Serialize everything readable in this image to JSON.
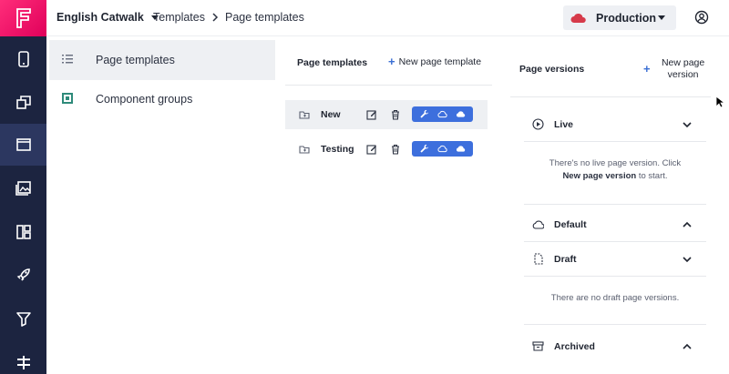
{
  "colors": {
    "rail": "#1c2440",
    "rail_active": "#2c3760",
    "brand": "#ff2d7a",
    "accent": "#3d6fdd",
    "env_cloud": "#d63a4a"
  },
  "rail": {
    "logo_icon": "flotiq-logo-icon",
    "items": [
      {
        "icon": "device-icon",
        "active": false
      },
      {
        "icon": "layers-icon",
        "active": false
      },
      {
        "icon": "window-icon",
        "active": true
      },
      {
        "icon": "gallery-icon",
        "active": false
      },
      {
        "icon": "dashboard-icon",
        "active": false
      },
      {
        "icon": "rocket-icon",
        "active": false
      },
      {
        "icon": "filter-icon",
        "active": false
      },
      {
        "icon": "plugins-icon",
        "active": false
      }
    ]
  },
  "topbar": {
    "project": "English Catwalk",
    "breadcrumb": [
      "Templates",
      "Page templates"
    ],
    "environment": "Production"
  },
  "sidebar": {
    "items": [
      {
        "label": "Page templates",
        "icon": "list-icon",
        "active": true
      },
      {
        "label": "Component groups",
        "icon": "square-icon",
        "active": false
      }
    ]
  },
  "templates": {
    "title": "Page templates",
    "new_label": "New page template",
    "rows": [
      {
        "name": "New"
      },
      {
        "name": "Testing"
      }
    ]
  },
  "versions": {
    "title": "Page versions",
    "new_label": "New page version",
    "live_label": "Live",
    "live_empty_text": "There's no live page version. Click",
    "live_empty_link": "New page version",
    "live_empty_suffix": "to start.",
    "default_label": "Default",
    "draft_label": "Draft",
    "draft_empty_text": "There are no draft page versions.",
    "archived_label": "Archived"
  }
}
